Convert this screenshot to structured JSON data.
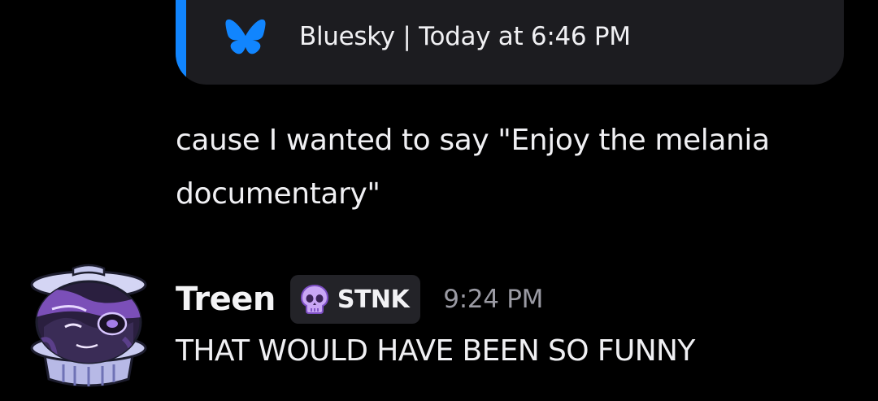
{
  "embed": {
    "icon": "bluesky-butterfly-icon",
    "source": "Bluesky",
    "separator": "|",
    "timestamp": "Today at 6:46 PM",
    "footer": "Bluesky | Today at 6:46 PM",
    "accent_color": "#1185fe"
  },
  "previous_message": {
    "text": "cause I wanted to say \"Enjoy the melania documentary\""
  },
  "message": {
    "avatar": "trash-can-character-avatar",
    "username": "Treen",
    "tag": {
      "icon": "purple-skull-icon",
      "label": "STNK"
    },
    "time": "9:24 PM",
    "text": "THAT WOULD HAVE BEEN SO FUNNY"
  }
}
